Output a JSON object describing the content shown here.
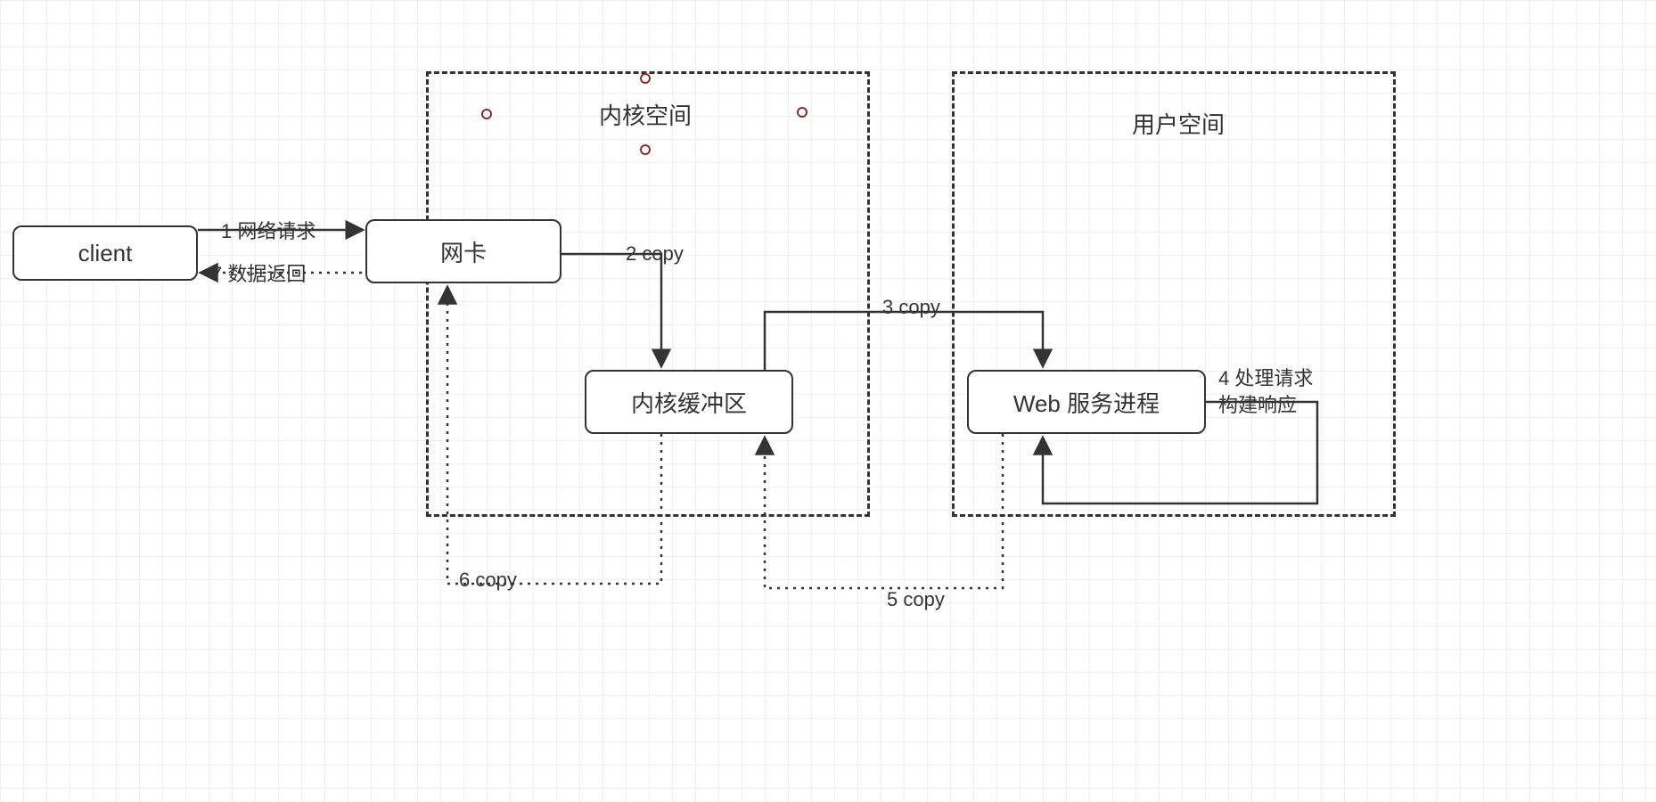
{
  "containers": {
    "kernel_space": "内核空间",
    "user_space": "用户空间"
  },
  "nodes": {
    "client": "client",
    "nic": "网卡",
    "kernel_buffer": "内核缓冲区",
    "web_process": "Web 服务进程"
  },
  "edges": {
    "e1": "1 网络请求",
    "e2": "2 copy",
    "e3": "3 copy",
    "e4_line1": "4 处理请求",
    "e4_line2": "构建响应",
    "e5": "5 copy",
    "e6": "6 copy",
    "e7": "7 数据返回"
  }
}
